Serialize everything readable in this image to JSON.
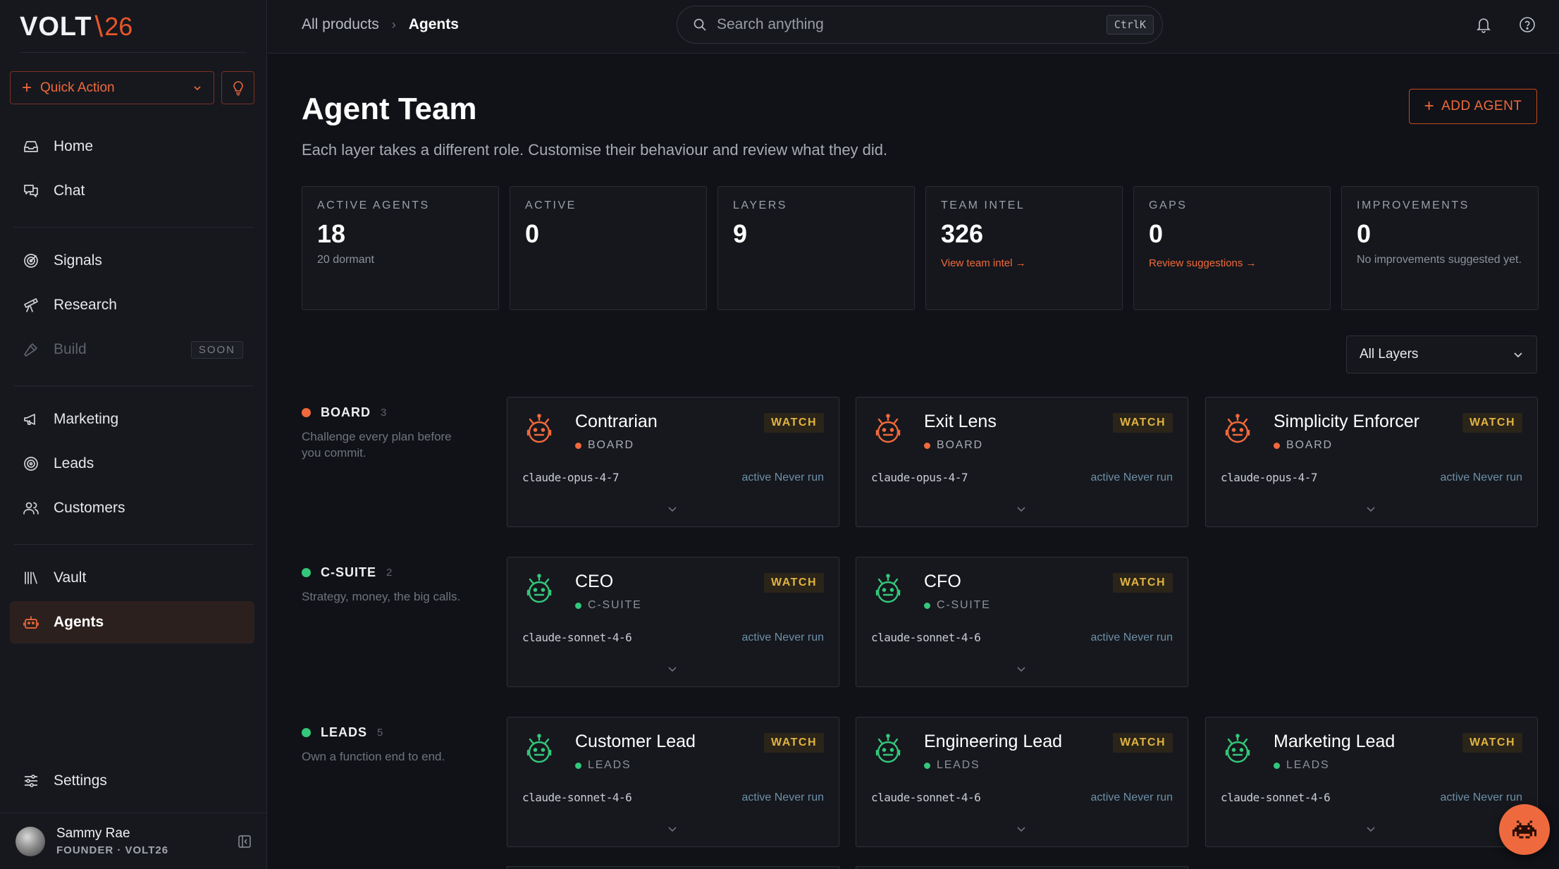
{
  "brand": {
    "name": "VOLT",
    "slash": "\\",
    "number": "26",
    "accent": "#e8562a"
  },
  "sidebar": {
    "quick_action": "Quick Action",
    "groups": [
      [
        {
          "label": "Home",
          "icon": "inbox-icon"
        },
        {
          "label": "Chat",
          "icon": "chat-icon"
        }
      ],
      [
        {
          "label": "Signals",
          "icon": "signals-icon"
        },
        {
          "label": "Research",
          "icon": "telescope-icon"
        },
        {
          "label": "Build",
          "icon": "hammer-icon",
          "badge": "SOON",
          "disabled": true
        }
      ],
      [
        {
          "label": "Marketing",
          "icon": "megaphone-icon"
        },
        {
          "label": "Leads",
          "icon": "target-icon"
        },
        {
          "label": "Customers",
          "icon": "users-icon"
        }
      ],
      [
        {
          "label": "Vault",
          "icon": "library-icon"
        },
        {
          "label": "Agents",
          "icon": "bot-icon",
          "active": true
        }
      ]
    ],
    "settings": "Settings",
    "user": {
      "name": "Sammy Rae",
      "role": "FOUNDER · VOLT26"
    }
  },
  "topbar": {
    "breadcrumb": [
      "All products",
      "Agents"
    ],
    "search_placeholder": "Search anything",
    "shortcut": "CtrlK"
  },
  "page": {
    "title": "Agent Team",
    "subtitle": "Each layer takes a different role. Customise their behaviour and review what they did.",
    "add_agent": "ADD AGENT",
    "layer_filter": "All Layers"
  },
  "stats": [
    {
      "label": "ACTIVE AGENTS",
      "value": "18",
      "note": "20 dormant"
    },
    {
      "label": "ACTIVE",
      "value": "0"
    },
    {
      "label": "LAYERS",
      "value": "9"
    },
    {
      "label": "TEAM INTEL",
      "value": "326",
      "link": "View team intel →"
    },
    {
      "label": "GAPS",
      "value": "0",
      "link": "Review suggestions →"
    },
    {
      "label": "IMPROVEMENTS",
      "value": "0",
      "note": "No improvements suggested yet."
    }
  ],
  "layers": [
    {
      "name": "BOARD",
      "count": "3",
      "color": "#f0693c",
      "icon_color": "#f0693c",
      "description": "Challenge every plan before you commit.",
      "agents": [
        {
          "name": "Contrarian",
          "model": "claude-opus-4-7",
          "status": "active Never run",
          "badge": "WATCH"
        },
        {
          "name": "Exit Lens",
          "model": "claude-opus-4-7",
          "status": "active Never run",
          "badge": "WATCH"
        },
        {
          "name": "Simplicity Enforcer",
          "model": "claude-opus-4-7",
          "status": "active Never run",
          "badge": "WATCH"
        }
      ]
    },
    {
      "name": "C-SUITE",
      "count": "2",
      "color": "#34c77b",
      "icon_color": "#34c77b",
      "description": "Strategy, money, the big calls.",
      "agents": [
        {
          "name": "CEO",
          "model": "claude-sonnet-4-6",
          "status": "active Never run",
          "badge": "WATCH"
        },
        {
          "name": "CFO",
          "model": "claude-sonnet-4-6",
          "status": "active Never run",
          "badge": "WATCH"
        }
      ]
    },
    {
      "name": "LEADS",
      "count": "5",
      "color": "#34c77b",
      "icon_color": "#34c77b",
      "description": "Own a function end to end.",
      "agents": [
        {
          "name": "Customer Lead",
          "model": "claude-sonnet-4-6",
          "status": "active Never run",
          "badge": "WATCH"
        },
        {
          "name": "Engineering Lead",
          "model": "claude-sonnet-4-6",
          "status": "active Never run",
          "badge": "WATCH"
        },
        {
          "name": "Marketing Lead",
          "model": "claude-sonnet-4-6",
          "status": "active Never run",
          "badge": "WATCH"
        }
      ]
    }
  ]
}
